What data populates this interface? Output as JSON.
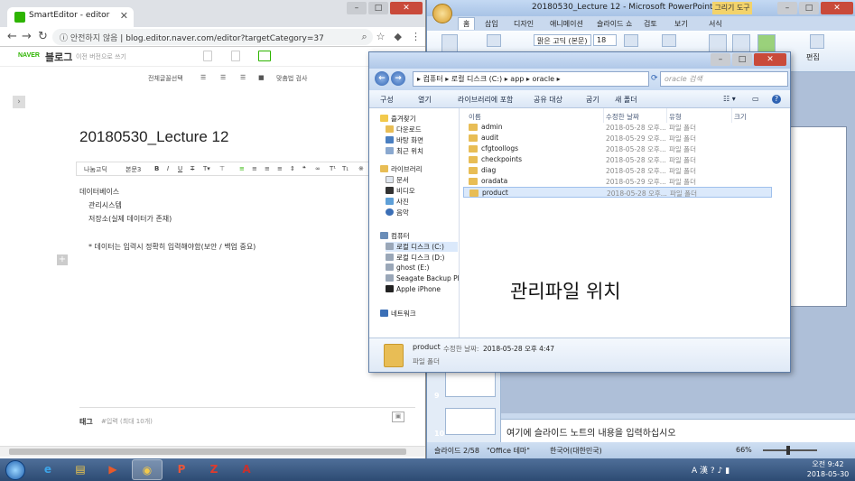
{
  "chrome": {
    "tab_title": "SmartEditor - editor",
    "secure_label": "안전하지 않음",
    "url": "blog.editor.naver.com/editor?targetCategory=37",
    "naver_logo": "NAVER",
    "blog_word": "블로그",
    "prev_version_link": "이전 버전으로 쓰기",
    "tools": {
      "select_all": "전체글꼴선택",
      "spellcheck": "맞춤법 검사"
    },
    "doc_title": "20180530_Lecture 12",
    "format_bar": {
      "font": "나눔고딕",
      "size": "본문3",
      "bold": "B",
      "italic": "I",
      "underline": "U",
      "strike": "T"
    },
    "body_lines": [
      "데이터베이스",
      "관리시스템",
      "저장소(실제 데이터가 존재)",
      "* 데이터는 입력시 정확히 입력해야함(보안 / 백업 중요)"
    ],
    "tag_label": "태그",
    "tag_placeholder": "#입력 (최대 10개)"
  },
  "ppt": {
    "title": "20180530_Lecture 12 - Microsoft PowerPoint",
    "drawing_tools": "그리기 도구",
    "tabs": [
      "홈",
      "삽입",
      "디자인",
      "애니메이션",
      "슬라이드 쇼",
      "검토",
      "보기",
      "서식"
    ],
    "font_name": "맑은 고딕 (본문)",
    "font_size": "18",
    "edit_label": "편집",
    "slide_numbers": [
      "9",
      "10"
    ],
    "notes_placeholder": "여기에 슬라이드 노트의 내용을 입력하십시오",
    "status": {
      "slide": "슬라이드 2/58",
      "theme": "\"Office 테마\"",
      "language": "한국어(대한민국)",
      "zoom": "66%"
    }
  },
  "explorer": {
    "breadcrumb": [
      "컴퓨터",
      "로컬 디스크 (C:)",
      "app",
      "oracle"
    ],
    "search_placeholder": "oracle 검색",
    "commands": [
      "구성",
      "열기",
      "라이브러리에 포함",
      "공유 대상",
      "굽기",
      "새 폴더"
    ],
    "nav": {
      "favorites": "즐겨찾기",
      "fav_items": [
        "다운로드",
        "바탕 화면",
        "최근 위치"
      ],
      "libraries": "라이브러리",
      "lib_items": [
        "문서",
        "비디오",
        "사진",
        "음악"
      ],
      "computer": "컴퓨터",
      "comp_items": [
        "로컬 디스크 (C:)",
        "로컬 디스크 (D:)",
        "ghost (E:)",
        "Seagate Backup Plu",
        "Apple iPhone"
      ],
      "network": "네트워크"
    },
    "columns": [
      "이름",
      "수정한 날짜",
      "유형",
      "크기"
    ],
    "files": [
      {
        "name": "admin",
        "date": "2018-05-28 오후...",
        "type": "파일 폴더"
      },
      {
        "name": "audit",
        "date": "2018-05-29 오후...",
        "type": "파일 폴더"
      },
      {
        "name": "cfgtoollogs",
        "date": "2018-05-28 오후...",
        "type": "파일 폴더"
      },
      {
        "name": "checkpoints",
        "date": "2018-05-28 오후...",
        "type": "파일 폴더"
      },
      {
        "name": "diag",
        "date": "2018-05-28 오후...",
        "type": "파일 폴더"
      },
      {
        "name": "oradata",
        "date": "2018-05-29 오후...",
        "type": "파일 폴더"
      },
      {
        "name": "product",
        "date": "2018-05-28 오후...",
        "type": "파일 폴더"
      }
    ],
    "overlay_label": "관리파일 위치",
    "details": {
      "name": "product",
      "modified_label": "수정한 날짜:",
      "modified_value": "2018-05-28 오후 4:47",
      "type": "파일 폴더"
    }
  },
  "taskbar": {
    "tray_lang": "A 漢",
    "clock_time": "오전 9:42",
    "clock_date": "2018-05-30"
  }
}
